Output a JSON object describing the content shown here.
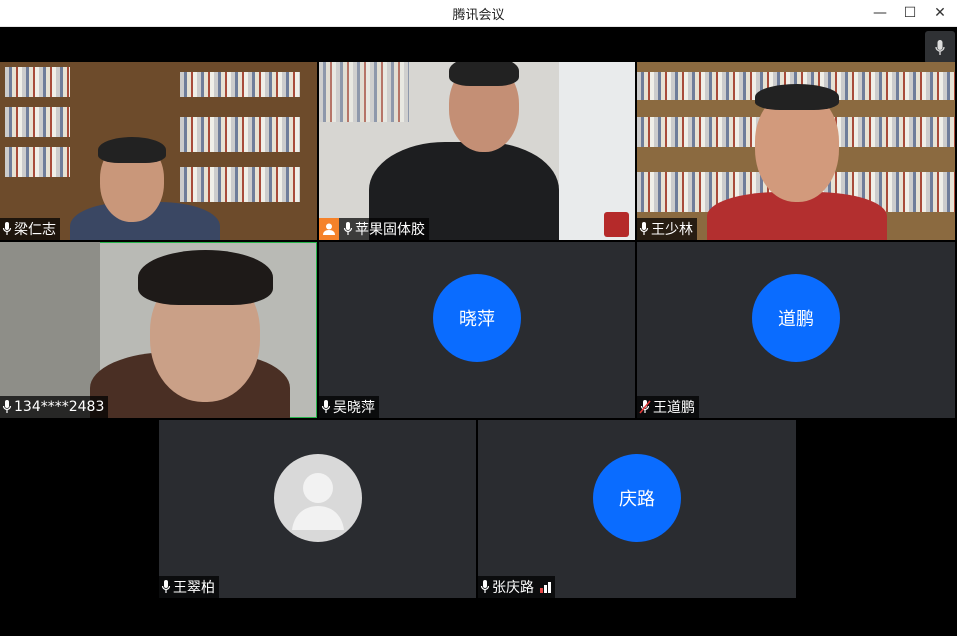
{
  "window": {
    "title": "腾讯会议",
    "minimize": "—",
    "maximize": "☐",
    "close": "✕"
  },
  "participants": [
    {
      "name": "梁仁志",
      "type": "video"
    },
    {
      "name": "苹果固体胶",
      "type": "video",
      "host": true
    },
    {
      "name": "王少林",
      "type": "video"
    },
    {
      "name": "134****2483",
      "type": "video",
      "speaking": true
    },
    {
      "name": "吴晓萍",
      "type": "avatar",
      "avatar_text": "晓萍"
    },
    {
      "name": "王道鹏",
      "type": "avatar",
      "avatar_text": "道鹏",
      "muted": true
    },
    {
      "name": "王翠柏",
      "type": "avatar-placeholder"
    },
    {
      "name": "张庆路",
      "type": "avatar",
      "avatar_text": "庆路",
      "signal": "weak"
    }
  ],
  "colors": {
    "avatar_blue": "#0a6cff",
    "tile_bg": "#2a2c30",
    "host_badge": "#f5822a",
    "speaking_outline": "#25b34a"
  },
  "icons": {
    "mic": "microphone-icon",
    "mic_muted": "microphone-muted-icon",
    "host": "user-host-icon",
    "signal": "signal-bars-icon"
  }
}
